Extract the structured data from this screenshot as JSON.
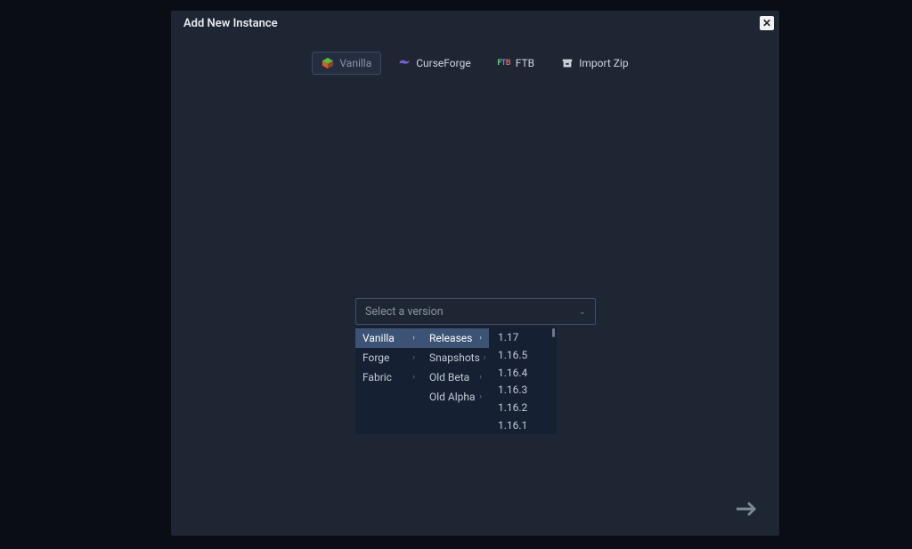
{
  "modal": {
    "title": "Add New Instance"
  },
  "tabs": {
    "items": [
      {
        "label": "Vanilla",
        "active": true,
        "icon": "cube-icon",
        "iconColor1": "#5fba3a",
        "iconColor2": "#c9602f"
      },
      {
        "label": "CurseForge",
        "active": false,
        "icon": "curseforge-icon",
        "iconColor1": "#7a5fd1"
      },
      {
        "label": "FTB",
        "active": false,
        "icon": "ftb-icon"
      },
      {
        "label": "Import Zip",
        "active": false,
        "icon": "archive-icon",
        "iconColor1": "#d0d4db"
      }
    ]
  },
  "versionSelect": {
    "placeholder": "Select a version"
  },
  "dropdown": {
    "loaders": [
      {
        "label": "Vanilla",
        "selected": true
      },
      {
        "label": "Forge",
        "selected": false
      },
      {
        "label": "Fabric",
        "selected": false
      }
    ],
    "channels": [
      {
        "label": "Releases",
        "selected": true
      },
      {
        "label": "Snapshots",
        "selected": false
      },
      {
        "label": "Old Beta",
        "selected": false
      },
      {
        "label": "Old Alpha",
        "selected": false
      }
    ],
    "versions": [
      {
        "label": "1.17"
      },
      {
        "label": "1.16.5"
      },
      {
        "label": "1.16.4"
      },
      {
        "label": "1.16.3"
      },
      {
        "label": "1.16.2"
      },
      {
        "label": "1.16.1"
      }
    ]
  }
}
